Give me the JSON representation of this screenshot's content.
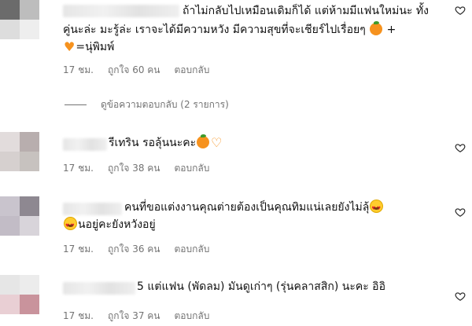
{
  "comments": [
    {
      "line1": "ถ้าไม่กลับไปเหมือนเดิมก็ได้ แต่ห้ามมีแฟนใหม่นะ ทั้ง",
      "line2a": "คู่นะล่ะ มะรู้ล่ะ เราจะได้มีความหวัง มีความสุขที่จะเชียร์ไปเรื่อยๆ",
      "line2b": "+",
      "line3": "=นุ่พิมพ์",
      "time": "17 ชม.",
      "likes": "ถูกใจ 60 คน",
      "reply": "ตอบกลับ"
    },
    {
      "line1": "รีเทริน รอลุ้นนะคะ",
      "time": "17 ชม.",
      "likes": "ถูกใจ 38 คน",
      "reply": "ตอบกลับ"
    },
    {
      "line1": "คนที่ขอแต่งงานคุณต่ายต้องเป็นคุณทิมแน่เลยยังไม่ลุ้",
      "line2": "นอยู่คะยังหวังอยู่",
      "time": "17 ชม.",
      "likes": "ถูกใจ 36 คน",
      "reply": "ตอบกลับ"
    },
    {
      "line1": "5 แต่แฟน (พัดลม) มันดูเก่าๆ (รุ่นคลาสสิก) นะคะ อิอิ",
      "time": "17 ชม.",
      "likes": "ถูกใจ 37 คน",
      "reply": "ตอบกลับ"
    }
  ],
  "view_replies": "ดูข้อความตอบกลับ (2 รายการ)",
  "icons": {
    "like": "heart-outline-icon",
    "orange": "tangerine-emoji",
    "heart": "orange-heart-emoji",
    "love": "heart-eyes-emoji"
  },
  "colors": {
    "text": "#111111",
    "meta": "#737373",
    "emoji_orange": "#f6921e"
  }
}
